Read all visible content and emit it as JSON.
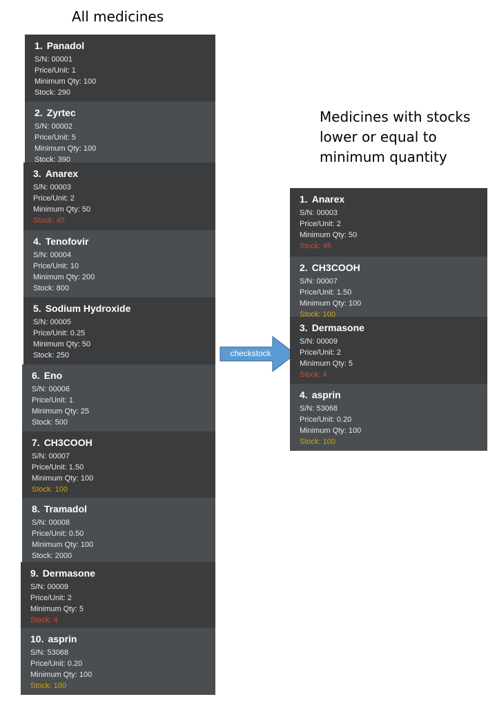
{
  "left_heading": "All medicines",
  "right_heading": "Medicines with stocks lower or equal to minimum quantity",
  "arrow_label": "checkstock",
  "labels": {
    "sn": "S/N: ",
    "price": "Price/Unit: ",
    "min": "Minimum Qty: ",
    "stock": "Stock: "
  },
  "colors": {
    "card_dark": "#3b3c3e",
    "card_light": "#4a4e51",
    "stock_below_min": "#e0472b",
    "stock_equal_min": "#d3a10f",
    "arrow": "#5b9bd5"
  },
  "all_medicines": [
    {
      "index": "1.",
      "name": "Panadol",
      "sn": "00001",
      "price": "1",
      "min_qty": "100",
      "stock": "290",
      "status": "ok"
    },
    {
      "index": "2.",
      "name": "Zyrtec",
      "sn": "00002",
      "price": "5",
      "min_qty": "100",
      "stock": "390",
      "status": "ok"
    },
    {
      "index": "3.",
      "name": "Anarex",
      "sn": "00003",
      "price": "2",
      "min_qty": "50",
      "stock": "45",
      "status": "low"
    },
    {
      "index": "4.",
      "name": "Tenofovir",
      "sn": "00004",
      "price": "10",
      "min_qty": "200",
      "stock": "800",
      "status": "ok"
    },
    {
      "index": "5.",
      "name": "Sodium Hydroxide",
      "sn": "00005",
      "price": "0.25",
      "min_qty": "50",
      "stock": "250",
      "status": "ok"
    },
    {
      "index": "6.",
      "name": "Eno",
      "sn": "00006",
      "price": "1",
      "min_qty": "25",
      "stock": "500",
      "status": "ok"
    },
    {
      "index": "7.",
      "name": "CH3COOH",
      "sn": "00007",
      "price": "1.50",
      "min_qty": "100",
      "stock": "100",
      "status": "equal"
    },
    {
      "index": "8.",
      "name": "Tramadol",
      "sn": "00008",
      "price": "0.50",
      "min_qty": "100",
      "stock": "2000",
      "status": "ok"
    },
    {
      "index": "9.",
      "name": "Dermasone",
      "sn": "00009",
      "price": "2",
      "min_qty": "5",
      "stock": "4",
      "status": "low"
    },
    {
      "index": "10.",
      "name": "asprin",
      "sn": "53068",
      "price": "0.20",
      "min_qty": "100",
      "stock": "100",
      "status": "equal"
    }
  ],
  "low_stock_medicines": [
    {
      "index": "1.",
      "name": "Anarex",
      "sn": "00003",
      "price": "2",
      "min_qty": "50",
      "stock": "45",
      "status": "low"
    },
    {
      "index": "2.",
      "name": "CH3COOH",
      "sn": "00007",
      "price": "1.50",
      "min_qty": "100",
      "stock": "100",
      "status": "equal"
    },
    {
      "index": "3.",
      "name": "Dermasone",
      "sn": "00009",
      "price": "2",
      "min_qty": "5",
      "stock": "4",
      "status": "low"
    },
    {
      "index": "4.",
      "name": "asprin",
      "sn": "53068",
      "price": "0.20",
      "min_qty": "100",
      "stock": "100",
      "status": "equal"
    }
  ]
}
